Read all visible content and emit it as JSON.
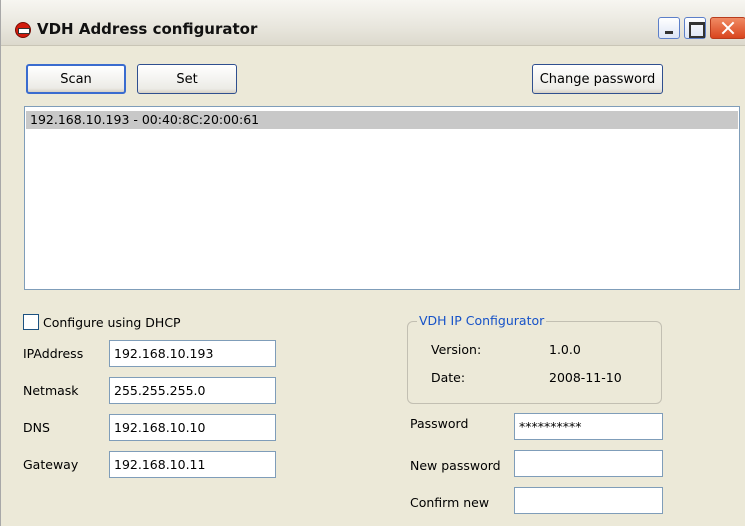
{
  "window": {
    "title": "VDH Address configurator"
  },
  "toolbar": {
    "scan_label": "Scan",
    "set_label": "Set",
    "change_password_label": "Change password"
  },
  "device_list": {
    "items": [
      {
        "text": "192.168.10.193 - 00:40:8C:20:00:61",
        "selected": true
      }
    ]
  },
  "network": {
    "dhcp_label": "Configure using DHCP",
    "dhcp_checked": false,
    "ip_label": "IPAddress",
    "ip_value": "192.168.10.193",
    "netmask_label": "Netmask",
    "netmask_value": "255.255.255.0",
    "dns_label": "DNS",
    "dns_value": "192.168.10.10",
    "gateway_label": "Gateway",
    "gateway_value": "192.168.10.11"
  },
  "info": {
    "group_title": "VDH IP Configurator",
    "version_label": "Version:",
    "version_value": "1.0.0",
    "date_label": "Date:",
    "date_value": "2008-11-10"
  },
  "password": {
    "password_label": "Password",
    "password_value": "**********",
    "new_password_label": "New password",
    "new_password_value": "",
    "confirm_label": "Confirm new",
    "confirm_value": ""
  },
  "icons": {
    "app": "app-icon",
    "minimize": "minimize-icon",
    "maximize": "maximize-icon",
    "close": "close-icon"
  },
  "colors": {
    "window_bg": "#ece9d8",
    "selection_bg": "#c8c8c8",
    "group_title": "#1652c8",
    "close_button": "#d9451e"
  }
}
